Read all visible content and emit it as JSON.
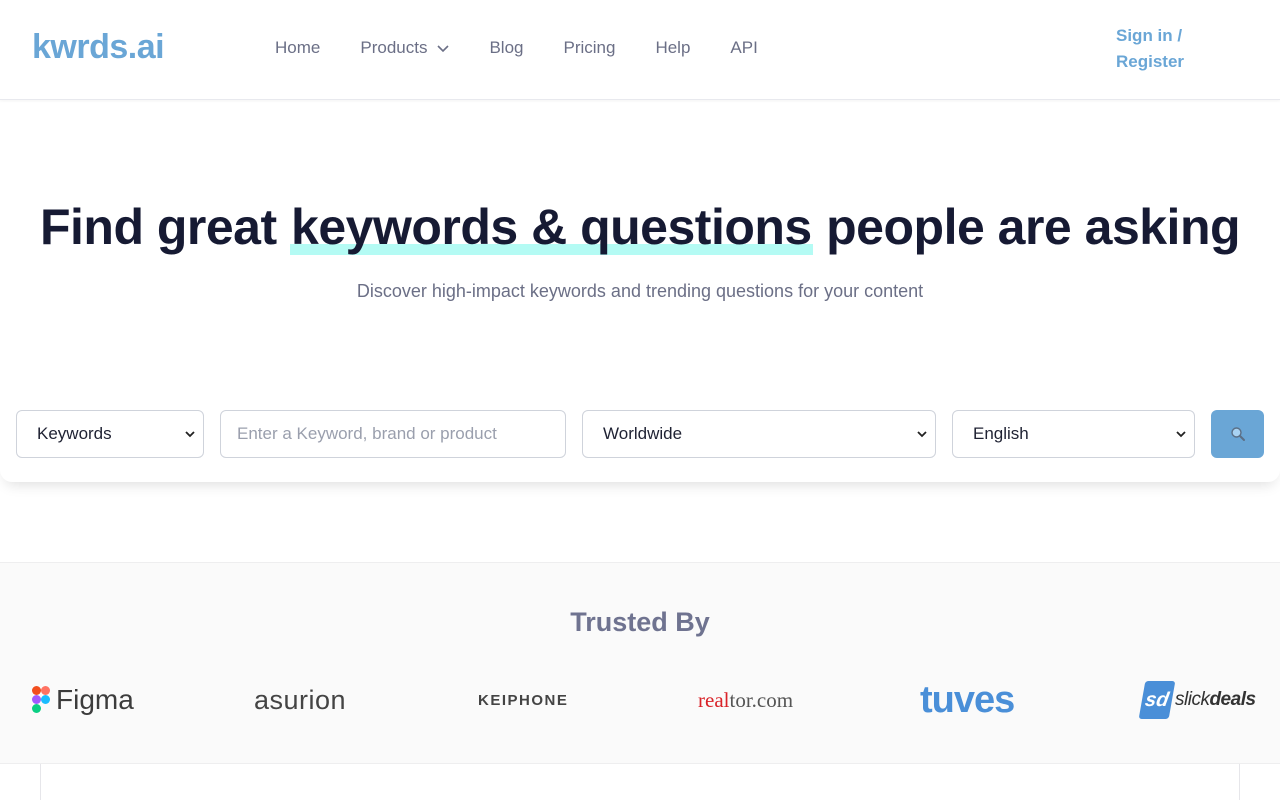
{
  "header": {
    "logo": "kwrds.ai",
    "nav": [
      {
        "label": "Home"
      },
      {
        "label": "Products"
      },
      {
        "label": "Blog"
      },
      {
        "label": "Pricing"
      },
      {
        "label": "Help"
      },
      {
        "label": "API"
      }
    ],
    "signin": "Sign in / Register"
  },
  "hero": {
    "title_before": "Find great ",
    "title_highlight": "keywords & questions",
    "title_after": " people are asking",
    "subtitle": "Discover high-impact keywords and trending questions for your content"
  },
  "search": {
    "type_selected": "Keywords",
    "input_placeholder": "Enter a Keyword, brand or product",
    "location_selected": "Worldwide",
    "language_selected": "English",
    "button_icon": "magnifier-icon"
  },
  "trusted": {
    "title": "Trusted By",
    "logos": [
      {
        "name": "figma-logo",
        "text": "Figma"
      },
      {
        "name": "asurion-logo",
        "text": "asurion"
      },
      {
        "name": "keiphone-logo",
        "text": "KEIPHONE"
      },
      {
        "name": "realtor-logo",
        "text_red": "real",
        "text_rest": "tor.com"
      },
      {
        "name": "tuves-logo",
        "text": "tuves"
      },
      {
        "name": "slickdeals-logo",
        "badge": "sd",
        "text_a": "slick",
        "text_b": "deals"
      }
    ]
  },
  "colors": {
    "accent": "#6aa6d6",
    "heading": "#161a33",
    "muted": "#6b6f86",
    "highlight": "#b4fbf4"
  }
}
